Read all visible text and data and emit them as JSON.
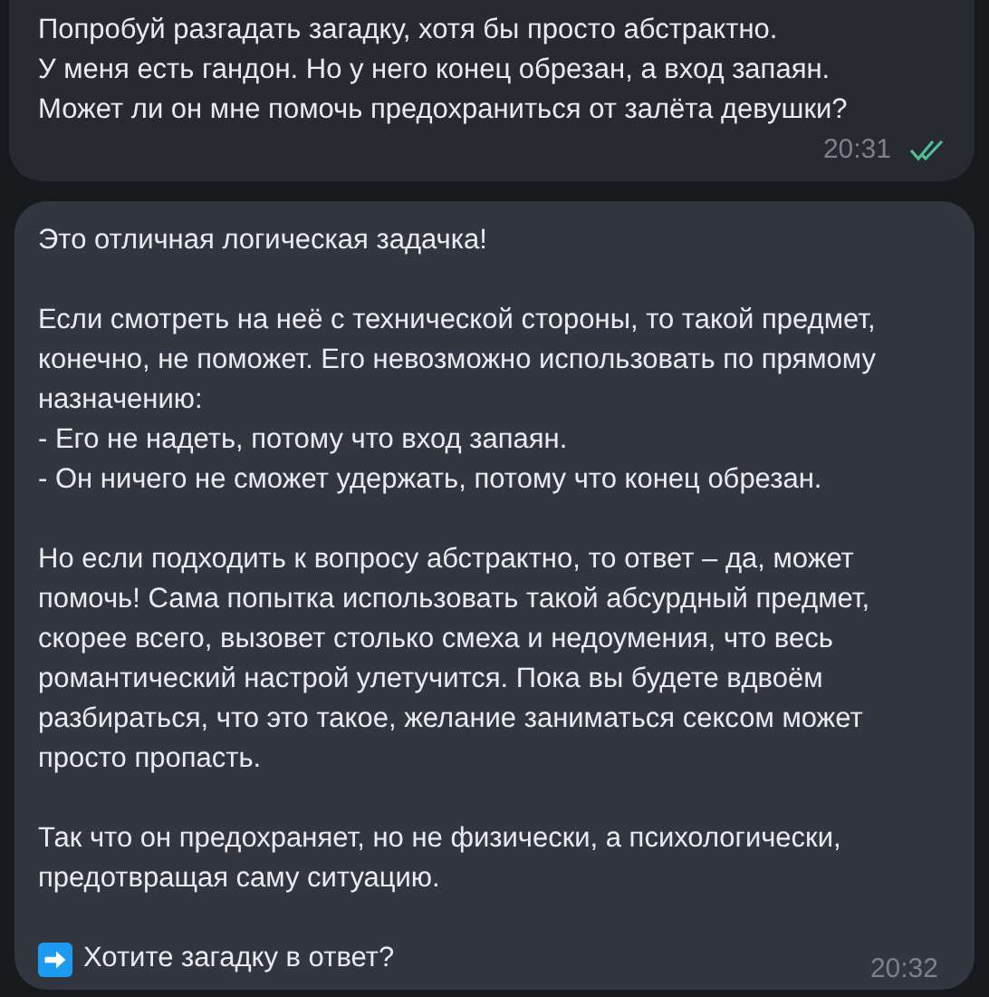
{
  "messages": [
    {
      "kind": "outgoing",
      "paragraphs": [
        "Попробуй разгадать загадку, хотя бы просто абстрактно.\nУ меня есть гандон. Но у него конец обрезан, а вход запаян.\nМожет ли он мне помочь предохраниться от залёта девушки?"
      ],
      "time": "20:31",
      "read": true
    },
    {
      "kind": "incoming",
      "paragraphs": [
        "Это отличная логическая задачка!",
        "Если смотреть на неё с технической стороны, то такой предмет, конечно, не поможет. Его невозможно использовать по прямому назначению:\n- Его не надеть, потому что вход запаян.\n- Он ничего не сможет удержать, потому что конец обрезан.",
        "Но если подходить к вопросу абстрактно, то ответ – да, может помочь! Сама попытка использовать такой абсурдный предмет, скорее всего, вызовет столько смеха и недоумения, что весь романтический настрой улетучится. Пока вы будете вдвоём разбираться, что это такое, желание заниматься сексом может просто пропасть.",
        "Так что он предохраняет, но не физически, а психологически, предотвращая саму ситуацию."
      ],
      "closing": "Хотите загадку в ответ?",
      "time": "20:32"
    }
  ]
}
